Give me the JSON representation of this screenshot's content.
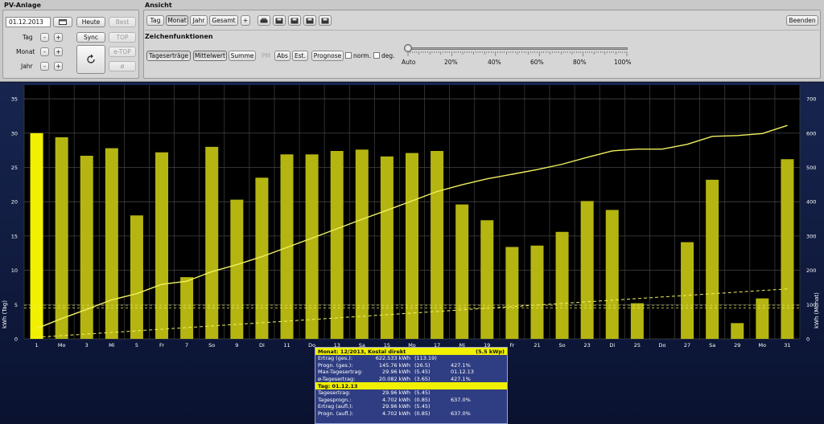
{
  "pv_panel": {
    "title": "PV-Anlage",
    "date_value": "01.12.2013",
    "heute": "Heute",
    "best": "Best",
    "tag": "Tag",
    "monat": "Monat",
    "jahr": "Jahr",
    "minus": "-",
    "plus": "+",
    "sync": "Sync",
    "top": "TOP",
    "e_top": "e-TOP",
    "avg": "ø"
  },
  "ansicht": {
    "title": "Ansicht",
    "tabs": [
      "Tag",
      "Monat",
      "Jahr",
      "Gesamt"
    ],
    "plus": "+",
    "beenden": "Beenden"
  },
  "zeichen": {
    "title": "Zeichenfunktionen",
    "buttons": [
      "Tageserträge",
      "Mittelwert",
      "Summe"
    ],
    "pm": "PM",
    "abs": "Abs",
    "est": "Est.",
    "prognose": "Prognose",
    "norm": "norm.",
    "deg": "deg.",
    "slider_labels": [
      "Auto",
      "20%",
      "40%",
      "60%",
      "80%",
      "100%"
    ]
  },
  "colors": {
    "bar": "#b5b512",
    "bar_highlight": "#f0f000",
    "line": "#f0f060",
    "chart_bg": "#0b1530"
  },
  "chart_data": {
    "type": "bar",
    "categories": [
      "1",
      "Mo",
      "3",
      "Mi",
      "5",
      "Fr",
      "7",
      "So",
      "9",
      "Di",
      "11",
      "Do",
      "13",
      "Sa",
      "15",
      "Mo",
      "17",
      "Mi",
      "19",
      "Fr",
      "21",
      "So",
      "23",
      "Di",
      "25",
      "Do",
      "27",
      "Sa",
      "29",
      "Mo",
      "31"
    ],
    "values": [
      30.0,
      29.4,
      26.7,
      27.8,
      18.0,
      27.2,
      9.0,
      28.0,
      20.3,
      23.5,
      26.9,
      26.9,
      27.4,
      27.6,
      26.6,
      27.1,
      27.4,
      19.6,
      17.3,
      13.4,
      13.6,
      15.6,
      20.1,
      18.8,
      5.2,
      0,
      14.1,
      23.2,
      2.3,
      5.9,
      26.2
    ],
    "highlight_index": 0,
    "ylabel": "kWh (Tag)",
    "y2label": "kWh (Monat)",
    "ylim": [
      0,
      37
    ],
    "y2lim": [
      0,
      740
    ],
    "yticks": [
      0,
      5,
      10,
      15,
      20,
      25,
      30,
      35
    ],
    "y2ticks": [
      0,
      100,
      200,
      300,
      400,
      500,
      600,
      700
    ],
    "cumulative": [
      29.96,
      59.36,
      86.06,
      113.86,
      131.86,
      159.06,
      168.06,
      196.06,
      216.36,
      239.86,
      266.76,
      293.66,
      321.06,
      348.66,
      375.26,
      402.36,
      429.76,
      449.36,
      466.66,
      480.06,
      493.66,
      509.26,
      529.36,
      548.16,
      553.36,
      553.36,
      567.46,
      590.66,
      592.96,
      598.86,
      622.53
    ],
    "forecast_cumulative_end": 145.76,
    "avg_line_1": 4.9,
    "avg_line_2": 4.5,
    "grid": true
  },
  "info": {
    "month_header": "Monat: 12/2013, Kostal direkt",
    "month_kwp": "(5.5 kWp)",
    "month_rows": [
      {
        "label": "Ertrag (ges.):",
        "value": "622.533 kWh",
        "paren": "(113.19)",
        "extra": ""
      },
      {
        "label": "Progn. (ges.):",
        "value": "145.76 kWh",
        "paren": "(26.5)",
        "extra": "427.1%"
      },
      {
        "label": "Max-Tagesertrag:",
        "value": "29.96 kWh",
        "paren": "(5.45)",
        "extra": "01.12.13"
      },
      {
        "label": "ø-Tagesertrag:",
        "value": "20.082 kWh",
        "paren": "(3.65)",
        "extra": "427.1%"
      }
    ],
    "day_header": "Tag: 01.12.13",
    "day_rows": [
      {
        "label": "Tagesertrag:",
        "value": "29.96 kWh",
        "paren": "(5.45)",
        "extra": ""
      },
      {
        "label": "Tagesprogn.:",
        "value": "4.702 kWh",
        "paren": "(0.85)",
        "extra": "637.0%"
      },
      {
        "label": "Ertrag (aufl.):",
        "value": "29.96 kWh",
        "paren": "(5.45)",
        "extra": ""
      },
      {
        "label": "Progn. (aufl.):",
        "value": "4.702 kWh",
        "paren": "(0.85)",
        "extra": "637.0%"
      }
    ]
  }
}
